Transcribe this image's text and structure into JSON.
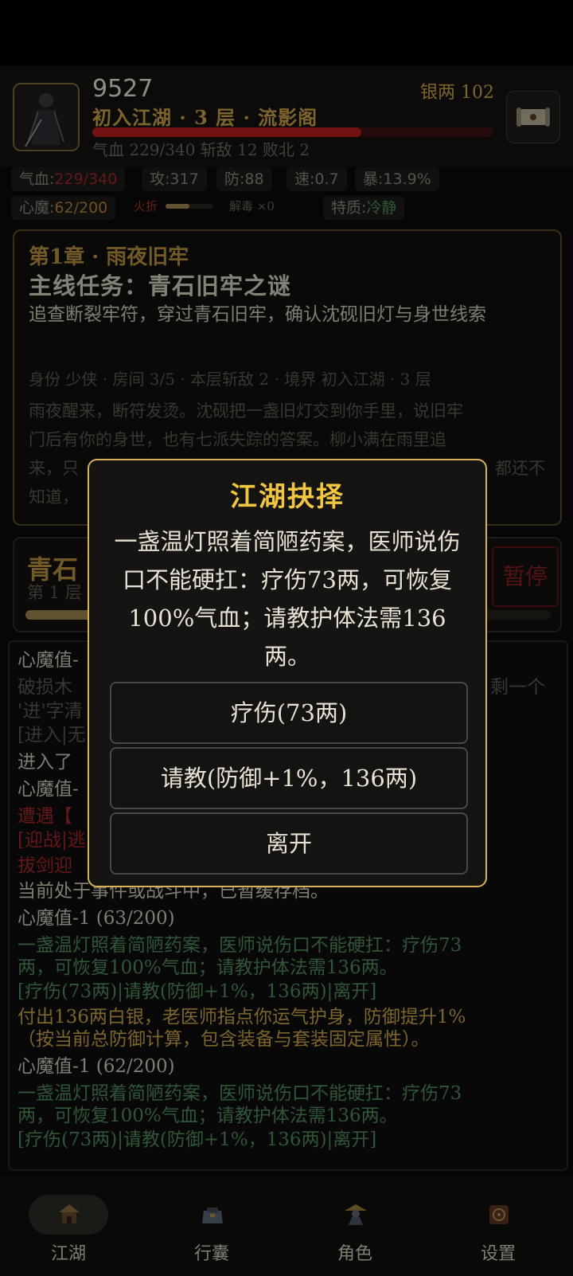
{
  "player": {
    "name": "9527",
    "silver": "银两 102",
    "realm": "初入江湖 · 3 层 · 流影阁",
    "hp_ratio": 0.67,
    "summary": "气血 229/340   斩敌 12   败北 2"
  },
  "stats": {
    "hp_label": "气血:",
    "hp_value": "229/340",
    "attack": "攻:317",
    "defense": "防:88",
    "speed": "速:0.7",
    "crit": "暴:13.9%",
    "demon_label": "心魔:",
    "demon_value": "62/200",
    "fire_label": "火折",
    "fire_level": 0.5,
    "antidote": "解毒 ×0",
    "trait_label": "特质:",
    "trait_value": "冷静"
  },
  "story": {
    "chapter": "第1章 · 雨夜旧牢",
    "mission": "主线任务：青石旧牢之谜",
    "mission_desc": "追查断裂牢符，穿过青石旧牢，确认沈砚旧灯与身世线索",
    "identity": "身份 少侠 · 房间 3/5 · 本层斩敌 2 · 境界 初入江湖 · 3 层",
    "text_1": "雨夜醒来，断符发烫。沈砚把一盏旧灯交到你手里，说旧牢",
    "text_2": "门后有你的身世，也有七派失踪的答案。柳小满在雨里追",
    "text_3": "来，只",
    "text_3b": "都还不",
    "text_4": "知道，"
  },
  "floor": {
    "title": "青石",
    "subtitle": "第 1 层",
    "pause_label": "暂停",
    "progress": 0.15
  },
  "log": {
    "l1": "心魔值-",
    "l2a": "破损木",
    "l2b": "剩一个",
    "l3": "'进'字清",
    "l4": "[进入|无",
    "l5": "进入了",
    "l6": "心魔值-",
    "l7": "遭遇【",
    "l8": "[迎战|逃",
    "l9": "拔剑迎",
    "l10": "当前处于事件或战斗中，已暂缓存档。",
    "l11": "心魔值-1 (63/200)",
    "l12": "一盏温灯照着简陋药案，医师说伤口不能硬扛：疗伤73",
    "l13": "两，可恢复100%气血；请教护体法需136两。",
    "l14": "[疗伤(73两)|请教(防御+1%，136两)|离开]",
    "l15": "付出136两白银，老医师指点你运气护身，防御提升1%",
    "l16": "（按当前总防御计算，包含装备与套装固定属性）。",
    "l17": "心魔值-1 (62/200)",
    "l18": "一盏温灯照着简陋药案，医师说伤口不能硬扛：疗伤73",
    "l19": "两，可恢复100%气血；请教护体法需136两。",
    "l20": "[疗伤(73两)|请教(防御+1%，136两)|离开]"
  },
  "modal": {
    "title": "江湖抉择",
    "body": "一盏温灯照着简陋药案，医师说伤口不能硬扛：疗伤73两，可恢复100%气血；请教护体法需136两。",
    "buttons": [
      "疗伤(73两)",
      "请教(防御+1%，136两)",
      "离开"
    ]
  },
  "tabs": [
    {
      "label": "江湖",
      "icon": "jianghu-icon",
      "active": true
    },
    {
      "label": "行囊",
      "icon": "bag-icon",
      "active": false
    },
    {
      "label": "角色",
      "icon": "character-icon",
      "active": false
    },
    {
      "label": "设置",
      "icon": "settings-icon",
      "active": false
    }
  ],
  "colors": {
    "gold": "#c9a24a",
    "modal_title": "#f0c542",
    "hp_red": "#b81d1d",
    "log_green": "#4f8a5a"
  }
}
